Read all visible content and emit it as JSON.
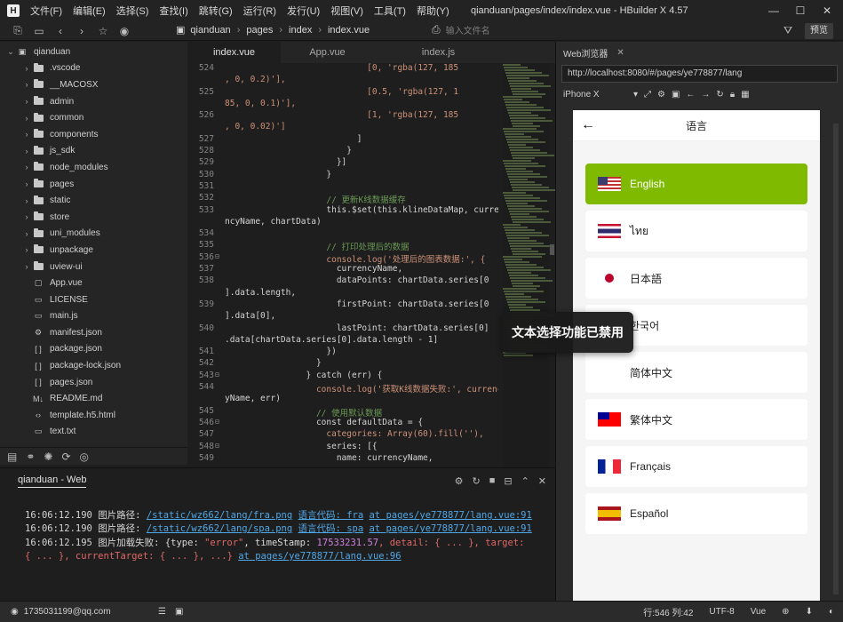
{
  "app": {
    "window_title": "qianduan/pages/index/index.vue - HBuilder X 4.57",
    "menu": [
      "文件(F)",
      "编辑(E)",
      "选择(S)",
      "查找(I)",
      "跳转(G)",
      "运行(R)",
      "发行(U)",
      "视图(V)",
      "工具(T)",
      "帮助(Y)"
    ]
  },
  "toolbar": {
    "breadcrumbs": [
      "qianduan",
      "pages",
      "index",
      "index.vue"
    ],
    "file_search_placeholder": "输入文件名",
    "preview_label": "预览"
  },
  "sidebar": {
    "project": "qianduan",
    "items": [
      {
        "label": ".vscode",
        "type": "folder"
      },
      {
        "label": "__MACOSX",
        "type": "folder"
      },
      {
        "label": "admin",
        "type": "folder"
      },
      {
        "label": "common",
        "type": "folder"
      },
      {
        "label": "components",
        "type": "folder"
      },
      {
        "label": "js_sdk",
        "type": "folder"
      },
      {
        "label": "node_modules",
        "type": "folder"
      },
      {
        "label": "pages",
        "type": "folder"
      },
      {
        "label": "static",
        "type": "folder"
      },
      {
        "label": "store",
        "type": "folder"
      },
      {
        "label": "uni_modules",
        "type": "folder"
      },
      {
        "label": "unpackage",
        "type": "folder"
      },
      {
        "label": "uview-ui",
        "type": "folder"
      },
      {
        "label": "App.vue",
        "type": "vue"
      },
      {
        "label": "LICENSE",
        "type": "file"
      },
      {
        "label": "main.js",
        "type": "js"
      },
      {
        "label": "manifest.json",
        "type": "manifest"
      },
      {
        "label": "package.json",
        "type": "json"
      },
      {
        "label": "package-lock.json",
        "type": "json"
      },
      {
        "label": "pages.json",
        "type": "json"
      },
      {
        "label": "README.md",
        "type": "md"
      },
      {
        "label": "template.h5.html",
        "type": "html"
      },
      {
        "label": "text.txt",
        "type": "file"
      }
    ]
  },
  "editor": {
    "tabs": [
      "index.vue",
      "App.vue",
      "index.js"
    ],
    "active_tab": 0,
    "lines": [
      {
        "n": "524",
        "fold": "",
        "text": "                            [0, 'rgba(127, 185"
      },
      {
        "n": "",
        "fold": "",
        "text": ", 0, 0.2)'],"
      },
      {
        "n": "525",
        "fold": "",
        "text": "                            [0.5, 'rgba(127, 1"
      },
      {
        "n": "",
        "fold": "",
        "text": "85, 0, 0.1)'],"
      },
      {
        "n": "526",
        "fold": "",
        "text": "                            [1, 'rgba(127, 185"
      },
      {
        "n": "",
        "fold": "",
        "text": ", 0, 0.02)']"
      },
      {
        "n": "527",
        "fold": "",
        "text": "                          ]"
      },
      {
        "n": "528",
        "fold": "",
        "text": "                        }"
      },
      {
        "n": "529",
        "fold": "",
        "text": "                      }]"
      },
      {
        "n": "530",
        "fold": "",
        "text": "                    }"
      },
      {
        "n": "531",
        "fold": "",
        "text": ""
      },
      {
        "n": "532",
        "fold": "",
        "text": "                    // 更新K线数据缓存"
      },
      {
        "n": "533",
        "fold": "",
        "text": "                    this.$set(this.klineDataMap, curre"
      },
      {
        "n": "",
        "fold": "",
        "text": "ncyName, chartData)"
      },
      {
        "n": "534",
        "fold": "",
        "text": ""
      },
      {
        "n": "535",
        "fold": "",
        "text": "                    // 打印处理后的数据"
      },
      {
        "n": "536",
        "fold": "⊟",
        "text": "                    console.log('处理后的图表数据:', {"
      },
      {
        "n": "537",
        "fold": "",
        "text": "                      currencyName,"
      },
      {
        "n": "538",
        "fold": "",
        "text": "                      dataPoints: chartData.series[0"
      },
      {
        "n": "",
        "fold": "",
        "text": "].data.length,"
      },
      {
        "n": "539",
        "fold": "",
        "text": "                      firstPoint: chartData.series[0"
      },
      {
        "n": "",
        "fold": "",
        "text": "].data[0],"
      },
      {
        "n": "540",
        "fold": "",
        "text": "                      lastPoint: chartData.series[0]"
      },
      {
        "n": "",
        "fold": "",
        "text": ".data[chartData.series[0].data.length - 1]"
      },
      {
        "n": "541",
        "fold": "",
        "text": "                    })"
      },
      {
        "n": "542",
        "fold": "",
        "text": "                  }"
      },
      {
        "n": "543",
        "fold": "⊟",
        "text": "                } catch (err) {"
      },
      {
        "n": "544",
        "fold": "",
        "text": "                  console.log('获取K线数据失败:', currenc"
      },
      {
        "n": "",
        "fold": "",
        "text": "yName, err)"
      },
      {
        "n": "545",
        "fold": "",
        "text": "                  // 使用默认数据"
      },
      {
        "n": "546",
        "fold": "⊟",
        "text": "                  const defaultData = {"
      },
      {
        "n": "547",
        "fold": "",
        "text": "                    categories: Array(60).fill(''),"
      },
      {
        "n": "548",
        "fold": "⊟",
        "text": "                    series: [{"
      },
      {
        "n": "549",
        "fold": "",
        "text": "                      name: currencyName,"
      }
    ]
  },
  "console": {
    "title": "qianduan - Web",
    "logs": [
      {
        "time": "16:06:12.190",
        "label": "图片路径:",
        "path": "/static/wz662/lang/fra.png",
        "code": "语言代码: fra",
        "at": "at pages/ye778877/lang.vue:91"
      },
      {
        "time": "16:06:12.190",
        "label": "图片路径:",
        "path": "/static/wz662/lang/spa.png",
        "code": "语言代码: spa",
        "at": "at pages/ye778877/lang.vue:91"
      }
    ],
    "error": {
      "time": "16:06:12.195",
      "prefix": "图片加载失败: {type: ",
      "type": "\"error\"",
      "ts_label": ", timeStamp: ",
      "ts": "17533231.57",
      "detail": ", detail: { ... }, target: { ... }, currentTarget: { ... }, ...}",
      "at": "at pages/ye778877/lang.vue:96"
    }
  },
  "toast": {
    "text": "文本选择功能已禁用"
  },
  "web": {
    "tab_label": "Web浏览器",
    "url": "http://localhost:8080/#/pages/ye778877/lang",
    "device": "iPhone X",
    "page_title": "语言",
    "languages": [
      {
        "name": "English",
        "flag": "us",
        "selected": true
      },
      {
        "name": "ไทย",
        "flag": "th",
        "selected": false
      },
      {
        "name": "日本語",
        "flag": "jp",
        "selected": false
      },
      {
        "name": "한국어",
        "flag": "kr",
        "selected": false
      },
      {
        "name": "简体中文",
        "flag": "none",
        "selected": false
      },
      {
        "name": "繁体中文",
        "flag": "tw",
        "selected": false
      },
      {
        "name": "Français",
        "flag": "fr",
        "selected": false
      },
      {
        "name": "Español",
        "flag": "es",
        "selected": false
      }
    ],
    "accent_color": "#7fba00"
  },
  "status": {
    "user": "1735031199@qq.com",
    "position": "行:546  列:42",
    "encoding": "UTF-8",
    "language": "Vue"
  }
}
